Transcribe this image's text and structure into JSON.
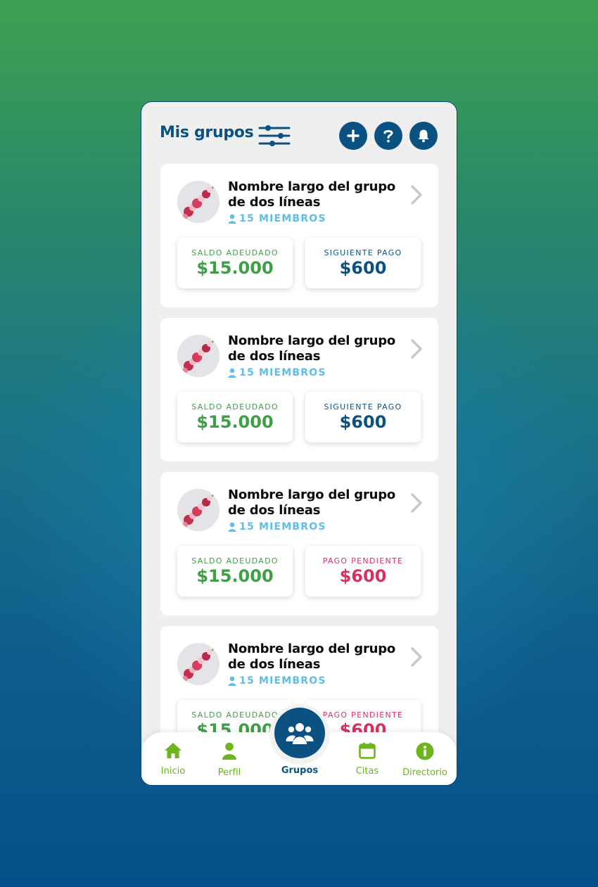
{
  "header": {
    "title": "Mis grupos",
    "filter_icon": "sliders-icon",
    "actions": [
      {
        "icon": "plus-icon"
      },
      {
        "icon": "question-icon"
      },
      {
        "icon": "bell-icon"
      }
    ]
  },
  "groups": [
    {
      "name": "Nombre largo del grupo de dos líneas",
      "members": "15 MIEMBROS",
      "balance_label": "SALDO ADEUDADO",
      "balance_value": "$15.000",
      "payment_label": "SIGUIENTE PAGO",
      "payment_value": "$600",
      "payment_status": "next"
    },
    {
      "name": "Nombre largo del grupo de dos líneas",
      "members": "15 MIEMBROS",
      "balance_label": "SALDO ADEUDADO",
      "balance_value": "$15.000",
      "payment_label": "SIGUIENTE PAGO",
      "payment_value": "$600",
      "payment_status": "next"
    },
    {
      "name": "Nombre largo del grupo de dos líneas",
      "members": "15 MIEMBROS",
      "balance_label": "SALDO ADEUDADO",
      "balance_value": "$15.000",
      "payment_label": "PAGO PENDIENTE",
      "payment_value": "$600",
      "payment_status": "pending"
    },
    {
      "name": "Nombre largo del grupo de dos líneas",
      "members": "15 MIEMBROS",
      "balance_label": "SALDO ADEUDADO",
      "balance_value": "$15.000",
      "payment_label": "PAGO PENDIENTE",
      "payment_value": "$600",
      "payment_status": "pending"
    }
  ],
  "nav": {
    "items": [
      {
        "label": "Inicio",
        "icon": "home-icon"
      },
      {
        "label": "Perfil",
        "icon": "user-icon"
      },
      {
        "label": "Grupos",
        "icon": "users-group-icon",
        "active": true
      },
      {
        "label": "Citas",
        "icon": "calendar-icon"
      },
      {
        "label": "Directorio",
        "icon": "info-icon"
      }
    ]
  },
  "colors": {
    "primary": "#0b5283",
    "green": "#3e9f46",
    "pending": "#d7325d",
    "members": "#5fbde6",
    "nav_green": "#6db41e"
  }
}
